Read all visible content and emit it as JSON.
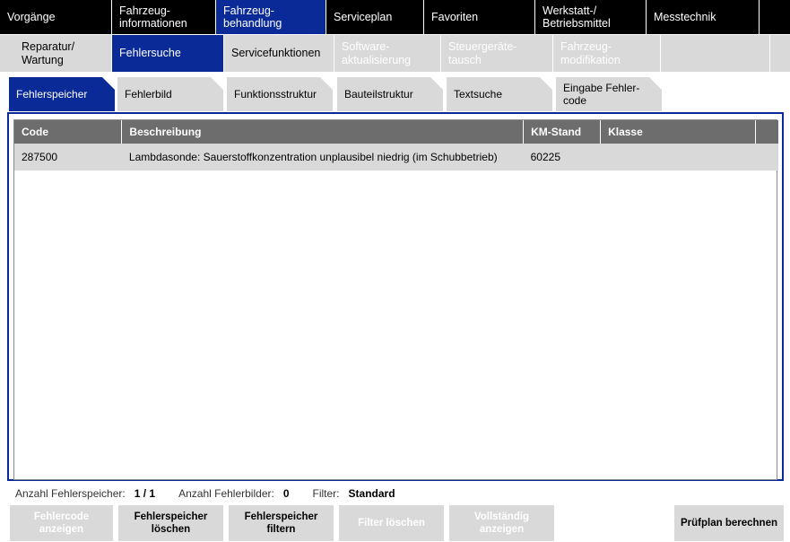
{
  "nav_main": [
    {
      "label": "Vorgänge",
      "active": false
    },
    {
      "label": "Fahrzeug-\ninformationen",
      "active": false
    },
    {
      "label": "Fahrzeug-\nbehandlung",
      "active": true
    },
    {
      "label": "Serviceplan",
      "active": false
    },
    {
      "label": "Favoriten",
      "active": false
    },
    {
      "label": "Werkstatt-/\nBetriebsmittel",
      "active": false
    },
    {
      "label": "Messtechnik",
      "active": false
    }
  ],
  "nav_sub": [
    {
      "label": "Reparatur/\nWartung",
      "state": "normal"
    },
    {
      "label": "Fehlersuche",
      "state": "active"
    },
    {
      "label": "Servicefunktionen",
      "state": "normal"
    },
    {
      "label": "Software-\naktualisierung",
      "state": "disabled"
    },
    {
      "label": "Steuergeräte-\ntausch",
      "state": "disabled"
    },
    {
      "label": "Fahrzeug-\nmodifikation",
      "state": "disabled"
    }
  ],
  "tabs": [
    {
      "label": "Fehlerspeicher",
      "active": true
    },
    {
      "label": "Fehlerbild",
      "active": false
    },
    {
      "label": "Funktionsstruktur",
      "active": false
    },
    {
      "label": "Bauteilstruktur",
      "active": false
    },
    {
      "label": "Textsuche",
      "active": false
    },
    {
      "label": "Eingabe Fehler-\ncode",
      "active": false
    }
  ],
  "table": {
    "columns": [
      "Code",
      "Beschreibung",
      "KM-Stand",
      "Klasse"
    ],
    "rows": [
      {
        "code": "287500",
        "description": "Lambdasonde: Sauerstoffkonzentration unplausibel niedrig (im Schubbetrieb)",
        "km": "60225",
        "klasse": ""
      }
    ]
  },
  "info": {
    "count_label": "Anzahl Fehlerspeicher:",
    "count_value": "1 / 1",
    "images_label": "Anzahl Fehlerbilder:",
    "images_value": "0",
    "filter_label": "Filter:",
    "filter_value": "Standard"
  },
  "buttons": [
    {
      "label": "Fehlercode\nanzeigen",
      "enabled": false
    },
    {
      "label": "Fehlerspeicher\nlöschen",
      "enabled": true
    },
    {
      "label": "Fehlerspeicher\nfiltern",
      "enabled": true
    },
    {
      "label": "Filter löschen",
      "enabled": false
    },
    {
      "label": "Vollständig\nanzeigen",
      "enabled": false
    },
    {
      "label": "Prüfplan berechnen",
      "enabled": true
    }
  ],
  "colors": {
    "accent": "#0a2a97",
    "header_gray": "#6d6d6d",
    "light_gray": "#d9d9d9"
  }
}
